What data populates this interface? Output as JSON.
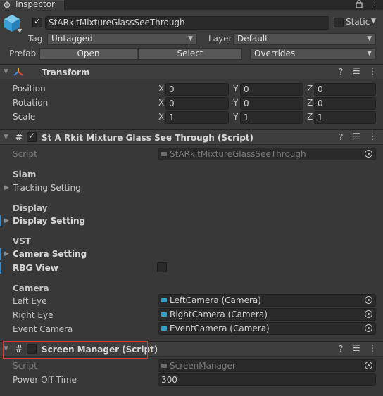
{
  "window": {
    "tab_title": "Inspector",
    "lock_icon": "lock-icon",
    "menu_icon": "kebab-menu-icon"
  },
  "gameobject": {
    "name": "StARkitMixtureGlassSeeThrough",
    "active": true,
    "static_label": "Static",
    "static_checked": false,
    "tag_label": "Tag",
    "tag_value": "Untagged",
    "layer_label": "Layer",
    "layer_value": "Default",
    "prefab_label": "Prefab",
    "open_label": "Open",
    "select_label": "Select",
    "overrides_label": "Overrides"
  },
  "transform": {
    "title": "Transform",
    "position_label": "Position",
    "rotation_label": "Rotation",
    "scale_label": "Scale",
    "position": {
      "x": "0",
      "y": "0",
      "z": "0"
    },
    "rotation": {
      "x": "0",
      "y": "0",
      "z": "0"
    },
    "scale": {
      "x": "1",
      "y": "1",
      "z": "1"
    },
    "axis_x": "X",
    "axis_y": "Y",
    "axis_z": "Z"
  },
  "script_component": {
    "title": "St A Rkit Mixture Glass See Through (Script)",
    "enabled": true,
    "script_label": "Script",
    "script_value": "StARkitMixtureGlassSeeThrough",
    "slam_header": "Slam",
    "tracking_setting": "Tracking Setting",
    "display_header": "Display",
    "display_setting": "Display Setting",
    "vst_header": "VST",
    "camera_setting": "Camera Setting",
    "rbg_view_label": "RBG View",
    "rbg_view_checked": false,
    "camera_header": "Camera",
    "left_eye_label": "Left Eye",
    "left_eye_value": "LeftCamera (Camera)",
    "right_eye_label": "Right Eye",
    "right_eye_value": "RightCamera (Camera)",
    "event_camera_label": "Event Camera",
    "event_camera_value": "EventCamera (Camera)"
  },
  "screen_manager": {
    "title": "Screen Manager (Script)",
    "enabled": false,
    "script_label": "Script",
    "script_value": "ScreenManager",
    "power_off_label": "Power Off Time",
    "power_off_value": "300"
  },
  "colors": {
    "background": "#383838",
    "field": "#2a2a2a",
    "highlight_box": "#d23a3a",
    "accent_blue": "#3c8ac8"
  }
}
